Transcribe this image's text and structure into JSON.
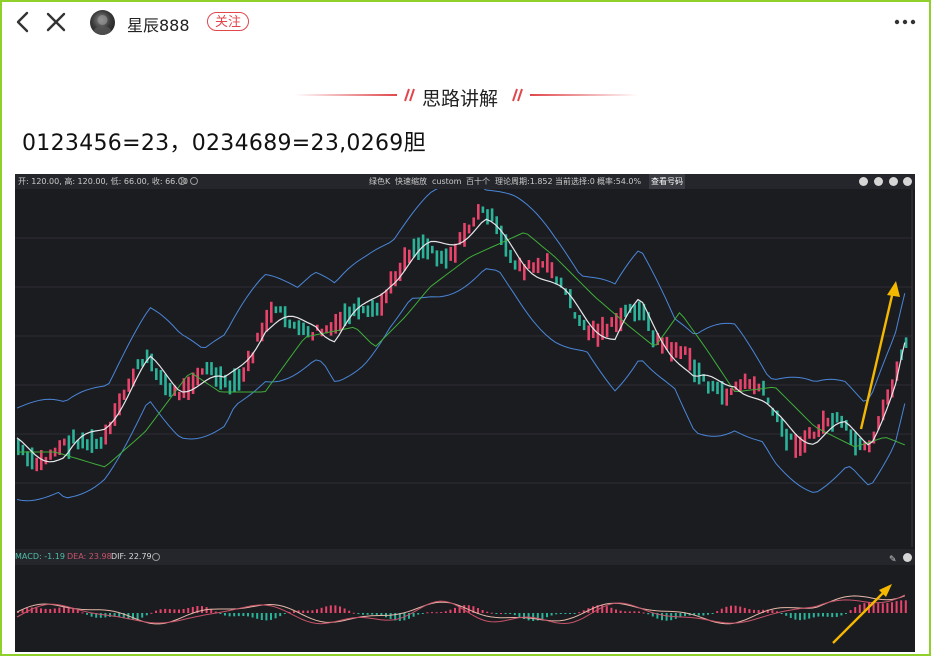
{
  "header": {
    "back_icon": "chevron-left-icon",
    "close_icon": "close-icon",
    "username": "星辰888",
    "follow_label": "关注",
    "more_icon": "more-dots-icon"
  },
  "article": {
    "section_title": "思路讲解",
    "headline": "0123456=23，0234689=23,0269胆"
  },
  "chart_toolbar": {
    "ohlc": "开: 120.00, 高: 120.00, 低: 66.00, 收: 66.00",
    "tab_green_k": "绿色K",
    "tab_fast_slow": "快速缩放",
    "tab_custom": "custom",
    "tab_hundred": "百十个",
    "cycle": "理论周期:1.852",
    "current": "当前选择:0",
    "accuracy": "概率:54.0%",
    "view_btn": "查看号码"
  },
  "macd": {
    "macd_label": "MACD: -1.19",
    "dea_label": "DEA: 23.98",
    "dif_label": "DIF: 22.79"
  },
  "colors": {
    "accent": "#e0474c",
    "frame": "#8fd12a",
    "up": "#e8436a",
    "down": "#2bb39a",
    "arrow": "#f5b800",
    "bollinger": "#4a86d8",
    "ma_white": "#e6e6ea",
    "ma_green": "#3fae3a"
  }
}
